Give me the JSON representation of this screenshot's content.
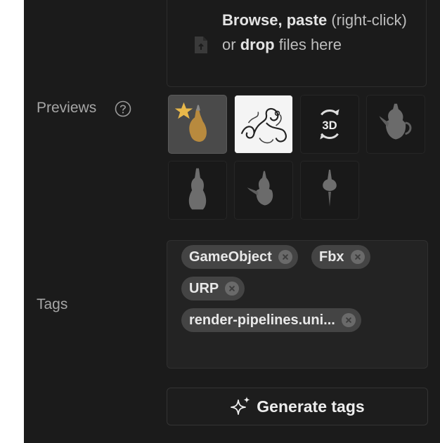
{
  "upload": {
    "browse": "Browse,",
    "paste": "paste",
    "right_click": "(right-click) or",
    "drop": "drop",
    "files_here": "files here",
    "icon": "file-upload-icon"
  },
  "previews": {
    "label": "Previews",
    "help_icon": "question-circle-icon",
    "items": [
      {
        "name": "thumbnail-vase-starred",
        "selected": true
      },
      {
        "name": "thumbnail-ornament-drawing"
      },
      {
        "name": "thumbnail-3d-view"
      },
      {
        "name": "thumbnail-teapot-side"
      },
      {
        "name": "thumbnail-teapot-front"
      },
      {
        "name": "thumbnail-teapot-angled"
      },
      {
        "name": "thumbnail-teapot-top"
      }
    ]
  },
  "tags": {
    "label": "Tags",
    "items": [
      "GameObject",
      "Fbx",
      "URP",
      "render-pipelines.uni..."
    ],
    "remove_icon": "close-circle-icon"
  },
  "generate": {
    "label": "Generate tags",
    "icon": "sparkle-icon"
  },
  "colors": {
    "panel_bg": "#1b1b1b",
    "chip_bg": "#444444",
    "star": "#e8b84a"
  }
}
